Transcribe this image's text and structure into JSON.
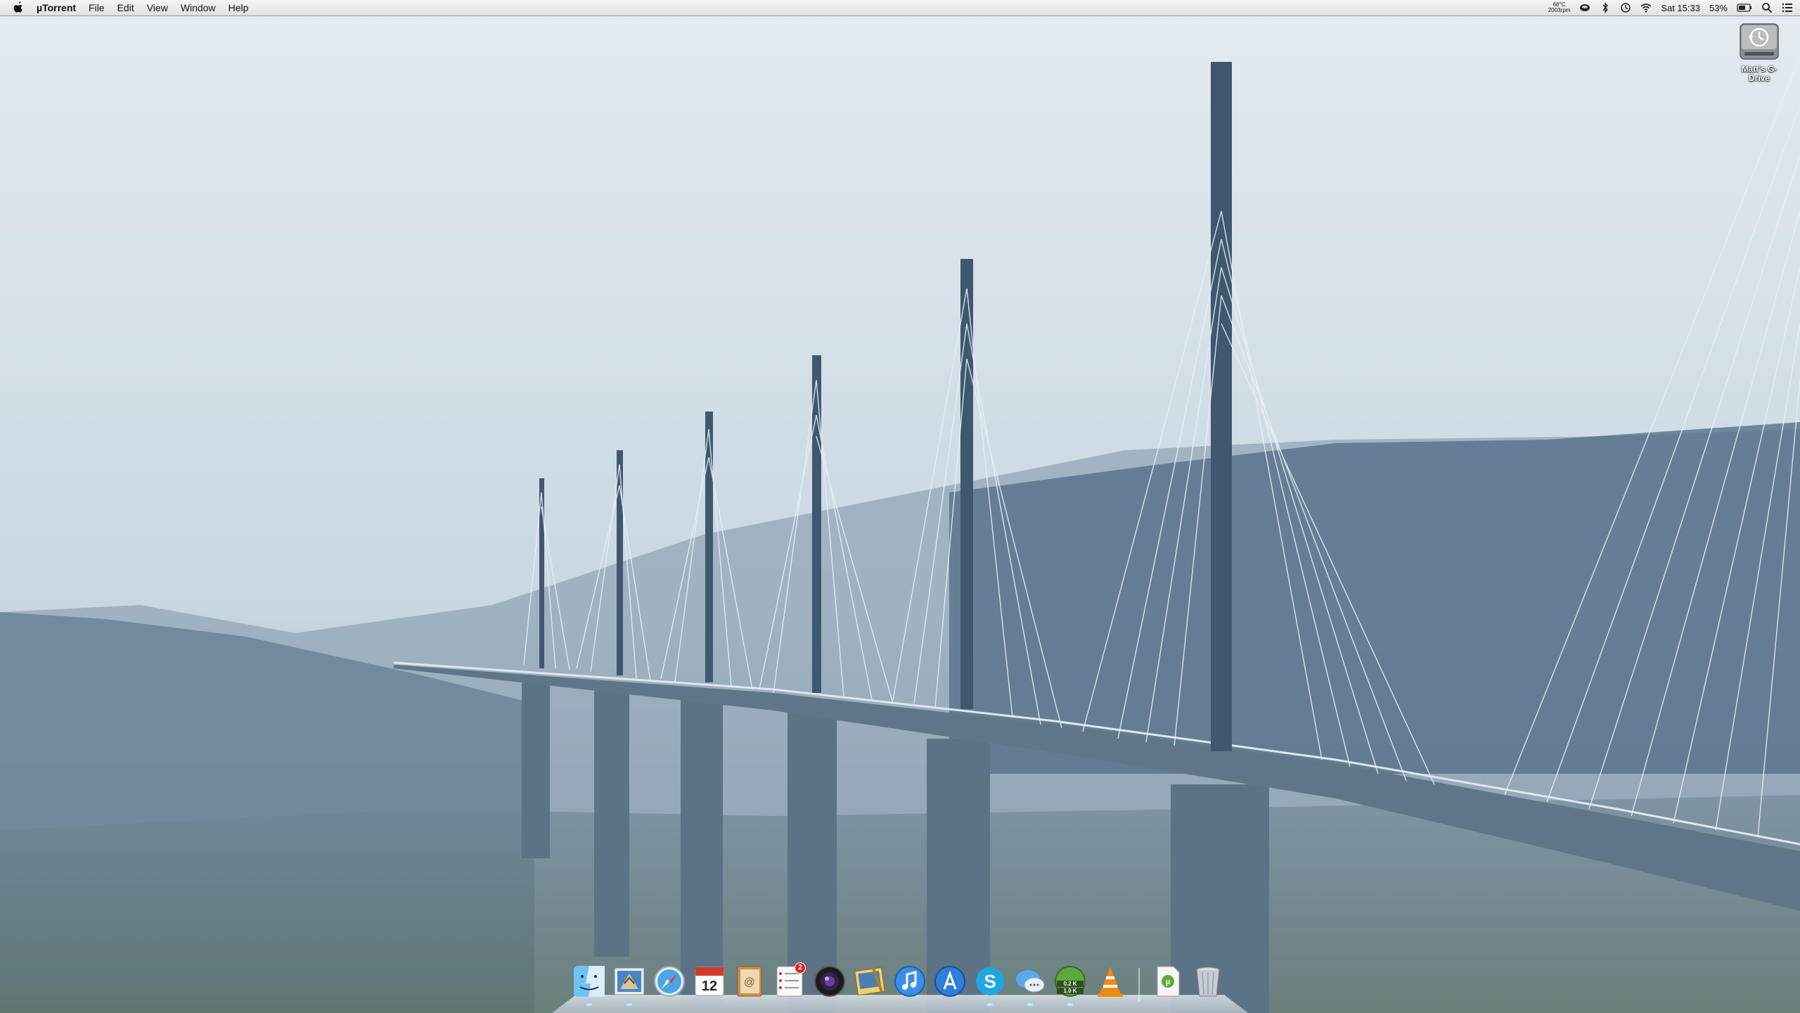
{
  "menubar": {
    "app_name": "µTorrent",
    "menus": [
      "File",
      "Edit",
      "View",
      "Window",
      "Help"
    ],
    "status": {
      "temp": "68°C",
      "fan": "2003rpm",
      "clock": "Sat 15:33",
      "battery": "53%"
    }
  },
  "desktop": {
    "drive_label": "Matt's G-Drive"
  },
  "dock": {
    "items": [
      {
        "name": "finder"
      },
      {
        "name": "mail"
      },
      {
        "name": "safari"
      },
      {
        "name": "ical",
        "text": "12"
      },
      {
        "name": "address-book"
      },
      {
        "name": "reminders",
        "badge": "2"
      },
      {
        "name": "photo-booth"
      },
      {
        "name": "iphoto"
      },
      {
        "name": "itunes"
      },
      {
        "name": "app-store"
      },
      {
        "name": "skype"
      },
      {
        "name": "messages"
      },
      {
        "name": "utorrent",
        "up": "0.2 K",
        "down": "1.0 K"
      },
      {
        "name": "vlc"
      },
      {
        "name": "utorrent-file"
      },
      {
        "name": "trash"
      }
    ]
  }
}
